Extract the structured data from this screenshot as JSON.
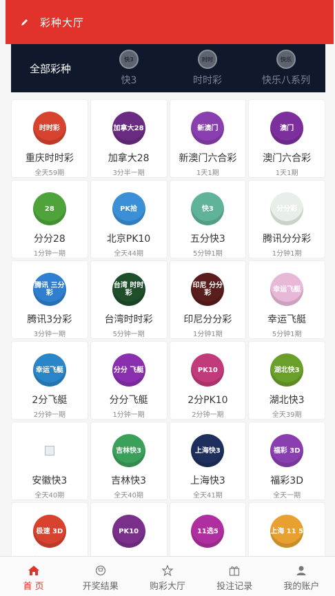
{
  "header": {
    "title": "彩种大厅",
    "icon": "pencil-icon",
    "bg": "#e1322b"
  },
  "categories": [
    {
      "label": "全部彩种",
      "icon": ""
    },
    {
      "label": "快3",
      "icon": "kuai3-icon"
    },
    {
      "label": "时时彩",
      "icon": "shishicai-icon"
    },
    {
      "label": "快乐八系列",
      "icon": "kuaile8-icon"
    }
  ],
  "lotteries": [
    {
      "name": "重庆时时彩",
      "sub": "全天59期",
      "logo_text": "时时彩",
      "color": "#d8432f"
    },
    {
      "name": "加拿大28",
      "sub": "3分半一期",
      "logo_text": "加拿大28",
      "color": "#6a2b82"
    },
    {
      "name": "新澳门六合彩",
      "sub": "1天1期",
      "logo_text": "新澳门",
      "color": "#8a3fb0"
    },
    {
      "name": "澳门六合彩",
      "sub": "1天1期",
      "logo_text": "澳门",
      "color": "#7d2f9e"
    },
    {
      "name": "分分28",
      "sub": "1分钟一期",
      "logo_text": "28",
      "color": "#4ea33a"
    },
    {
      "name": "北京PK10",
      "sub": "全天44期",
      "logo_text": "PK拾",
      "color": "#3a8fd6"
    },
    {
      "name": "五分快3",
      "sub": "5分钟1期",
      "logo_text": "快3",
      "color": "#5fb39a"
    },
    {
      "name": "腾讯分分彩",
      "sub": "1分钟1期",
      "logo_text": "分分彩",
      "color": "#e8efe9"
    },
    {
      "name": "腾讯3分彩",
      "sub": "3分钟一期",
      "logo_text": "腾讯 三分彩",
      "color": "#2f7fd0"
    },
    {
      "name": "台湾时时彩",
      "sub": "5分钟一期",
      "logo_text": "台湾 时时彩",
      "color": "#1f4e2b"
    },
    {
      "name": "印尼分分彩",
      "sub": "1分钟1期",
      "logo_text": "印尼 分分彩",
      "color": "#5a1d1d"
    },
    {
      "name": "幸运飞艇",
      "sub": "5分钟1期",
      "logo_text": "幸运飞艇",
      "color": "#e8b8d8"
    },
    {
      "name": "2分飞艇",
      "sub": "2分钟一期",
      "logo_text": "幸运飞艇",
      "color": "#2a86c8"
    },
    {
      "name": "分分飞艇",
      "sub": "1分钟一期",
      "logo_text": "分分 飞艇",
      "color": "#8a2fb0"
    },
    {
      "name": "2分PK10",
      "sub": "2分钟一期",
      "logo_text": "PK10",
      "color": "#c13a7a"
    },
    {
      "name": "湖北快3",
      "sub": "全天39期",
      "logo_text": "湖北快3",
      "color": "#6a9f2a"
    },
    {
      "name": "安徽快3",
      "sub": "全天40期",
      "logo_text": "",
      "color": "transparent",
      "broken": true
    },
    {
      "name": "吉林快3",
      "sub": "全天40期",
      "logo_text": "吉林快3",
      "color": "#3aa05a"
    },
    {
      "name": "上海快3",
      "sub": "全天41期",
      "logo_text": "上海快3",
      "color": "#1e2f5e"
    },
    {
      "name": "福彩3D",
      "sub": "全天一期",
      "logo_text": "福彩 3D",
      "color": "#8a3fb0"
    },
    {
      "name": "极速3D",
      "sub": "",
      "logo_text": "极速 3D",
      "color": "#d8432f"
    },
    {
      "name": "",
      "sub": "",
      "logo_text": "PK10",
      "color": "#7a2f8a"
    },
    {
      "name": "",
      "sub": "",
      "logo_text": "11选5",
      "color": "#b02fa0"
    },
    {
      "name": "",
      "sub": "",
      "logo_text": "上海 11 5",
      "color": "#e8a030"
    }
  ],
  "tabs": [
    {
      "label": "首 页",
      "icon": "home-icon",
      "active": true
    },
    {
      "label": "开奖结果",
      "icon": "trophy-icon",
      "active": false
    },
    {
      "label": "购彩大厅",
      "icon": "star-icon",
      "active": false
    },
    {
      "label": "投注记录",
      "icon": "gift-icon",
      "active": false
    },
    {
      "label": "我的账户",
      "icon": "user-icon",
      "active": false
    }
  ]
}
